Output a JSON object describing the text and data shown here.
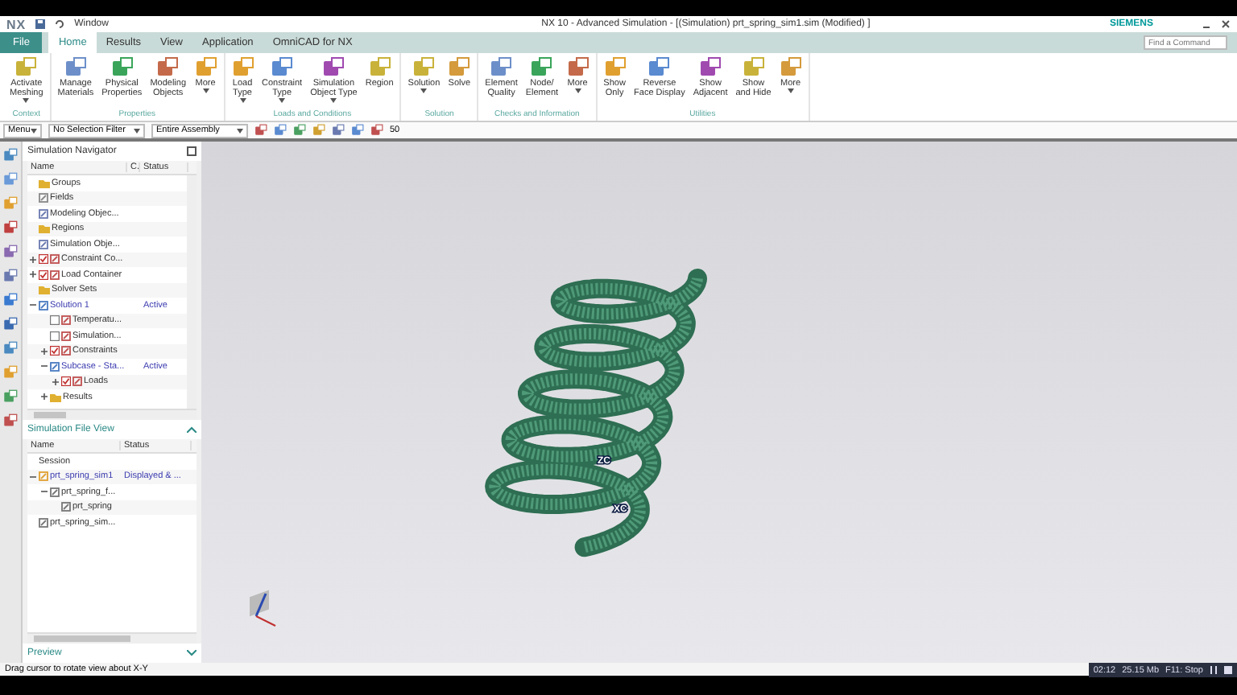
{
  "title_bar": {
    "logo": "NX",
    "quick_menu": "Window",
    "title": "NX 10 - Advanced Simulation - [(Simulation) prt_spring_sim1.sim (Modified) ]",
    "brand": "SIEMENS"
  },
  "tabs": [
    {
      "label": "File",
      "selected": false,
      "kind": "file"
    },
    {
      "label": "Home",
      "selected": true,
      "kind": "tab"
    },
    {
      "label": "Results",
      "selected": false,
      "kind": "tab"
    },
    {
      "label": "View",
      "selected": false,
      "kind": "tab"
    },
    {
      "label": "Application",
      "selected": false,
      "kind": "tab"
    },
    {
      "label": "OmniCAD for NX",
      "selected": false,
      "kind": "tab"
    }
  ],
  "command_search": {
    "placeholder": "Find a Command"
  },
  "ribbon_groups": [
    {
      "name": "Context",
      "buttons": [
        {
          "lines": [
            "Activate",
            "Meshing"
          ],
          "dropdown": true
        }
      ]
    },
    {
      "name": "Properties",
      "buttons": [
        {
          "lines": [
            "Manage",
            "Materials"
          ],
          "dropdown": false
        },
        {
          "lines": [
            "Physical",
            "Properties"
          ],
          "dropdown": false
        },
        {
          "lines": [
            "Modeling",
            "Objects"
          ],
          "dropdown": false
        },
        {
          "lines": [
            "More"
          ],
          "dropdown": true
        }
      ]
    },
    {
      "name": "Loads and Conditions",
      "buttons": [
        {
          "lines": [
            "Load",
            "Type"
          ],
          "dropdown": true
        },
        {
          "lines": [
            "Constraint",
            "Type"
          ],
          "dropdown": true
        },
        {
          "lines": [
            "Simulation",
            "Object Type"
          ],
          "dropdown": true
        },
        {
          "lines": [
            "Region"
          ],
          "dropdown": false
        }
      ]
    },
    {
      "name": "Solution",
      "buttons": [
        {
          "lines": [
            "Solution"
          ],
          "dropdown": true
        },
        {
          "lines": [
            "Solve"
          ],
          "dropdown": false
        }
      ]
    },
    {
      "name": "Checks and Information",
      "buttons": [
        {
          "lines": [
            "Element",
            "Quality"
          ],
          "dropdown": false
        },
        {
          "lines": [
            "Node/",
            "Element"
          ],
          "dropdown": false
        },
        {
          "lines": [
            "More"
          ],
          "dropdown": true
        }
      ]
    },
    {
      "name": "Utilities",
      "buttons": [
        {
          "lines": [
            "Show",
            "Only"
          ],
          "dropdown": false
        },
        {
          "lines": [
            "Reverse",
            "Face Display"
          ],
          "dropdown": false
        },
        {
          "lines": [
            "Show",
            "Adjacent"
          ],
          "dropdown": false
        },
        {
          "lines": [
            "Show",
            "and Hide"
          ],
          "dropdown": false
        },
        {
          "lines": [
            "More"
          ],
          "dropdown": true
        }
      ]
    }
  ],
  "toolbar": {
    "menu": "Menu",
    "selection_filter": "No Selection Filter",
    "assembly_scope": "Entire Assembly",
    "zoom_value": "50"
  },
  "simulation_navigator": {
    "title": "Simulation Navigator",
    "columns": [
      "Name",
      "C.",
      "Status"
    ],
    "items": [
      {
        "name": "Groups",
        "kind": "folder"
      },
      {
        "name": "Fields",
        "kind": "field"
      },
      {
        "name": "Modeling Objec...",
        "kind": "object"
      },
      {
        "name": "Regions",
        "kind": "folder"
      },
      {
        "name": "Simulation Obje...",
        "kind": "object"
      },
      {
        "name": "Constraint Co...",
        "kind": "container",
        "expanded": false,
        "checked": true
      },
      {
        "name": "Load Container",
        "kind": "container",
        "expanded": false,
        "checked": true
      },
      {
        "name": "Solver Sets",
        "kind": "folder"
      },
      {
        "name": "Solution 1",
        "kind": "solution",
        "expanded": true,
        "status": "Active",
        "children": [
          {
            "name": "Temperatu...",
            "kind": "container",
            "checked": false
          },
          {
            "name": "Simulation...",
            "kind": "container",
            "checked": false
          },
          {
            "name": "Constraints",
            "kind": "container",
            "expanded": false,
            "checked": true
          },
          {
            "name": "Subcase - Sta...",
            "kind": "solution",
            "expanded": true,
            "status": "Active",
            "children": [
              {
                "name": "Loads",
                "kind": "container",
                "expanded": false,
                "checked": true
              }
            ]
          },
          {
            "name": "Results",
            "kind": "folder",
            "expanded": false
          }
        ]
      }
    ]
  },
  "simulation_file_view": {
    "title": "Simulation File View",
    "expanded": true,
    "columns": [
      "Name",
      "Status"
    ],
    "items": [
      {
        "name": "Session",
        "kind": "label"
      },
      {
        "name": "prt_spring_sim1",
        "kind": "sim",
        "expanded": true,
        "status": "Displayed & ...",
        "children": [
          {
            "name": "prt_spring_f...",
            "kind": "part",
            "expanded": true,
            "children": [
              {
                "name": "prt_spring",
                "kind": "part"
              }
            ]
          }
        ]
      },
      {
        "name": "prt_spring_sim...",
        "kind": "part"
      }
    ]
  },
  "preview": {
    "title": "Preview",
    "expanded": false
  },
  "viewport": {
    "axis_labels": [
      "ZC",
      "XC"
    ]
  },
  "status_bar": {
    "message": "Drag cursor to rotate view about X-Y"
  },
  "recorder": {
    "time": "02:12",
    "size": "25.15 Mb",
    "hotkey": "F11: Stop"
  }
}
